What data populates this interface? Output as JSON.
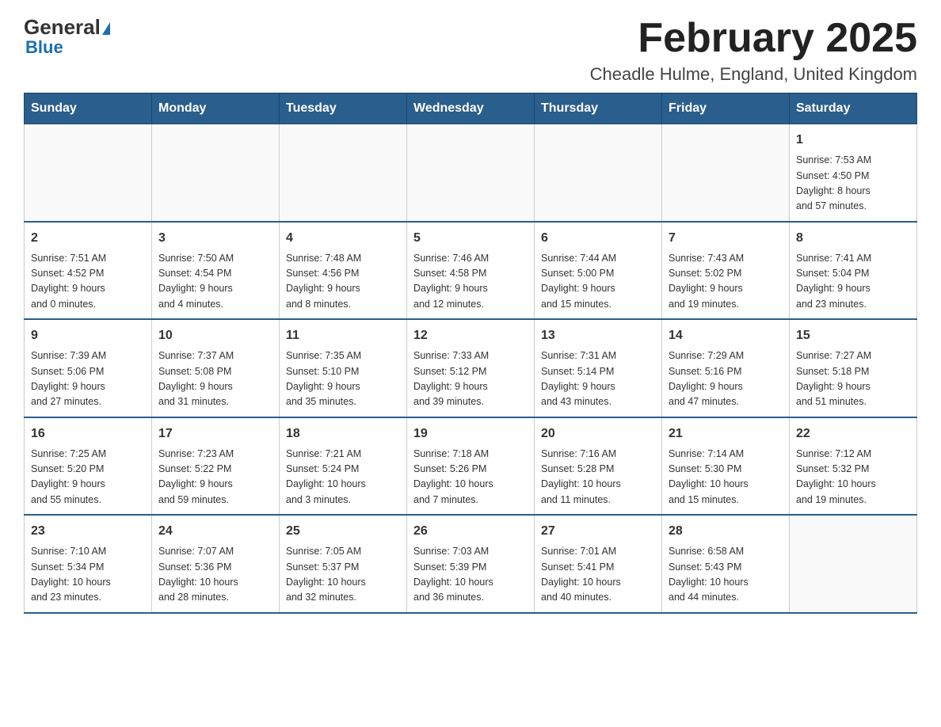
{
  "logo": {
    "general": "General",
    "blue": "Blue"
  },
  "title": "February 2025",
  "subtitle": "Cheadle Hulme, England, United Kingdom",
  "weekdays": [
    "Sunday",
    "Monday",
    "Tuesday",
    "Wednesday",
    "Thursday",
    "Friday",
    "Saturday"
  ],
  "weeks": [
    [
      {
        "day": "",
        "info": ""
      },
      {
        "day": "",
        "info": ""
      },
      {
        "day": "",
        "info": ""
      },
      {
        "day": "",
        "info": ""
      },
      {
        "day": "",
        "info": ""
      },
      {
        "day": "",
        "info": ""
      },
      {
        "day": "1",
        "info": "Sunrise: 7:53 AM\nSunset: 4:50 PM\nDaylight: 8 hours\nand 57 minutes."
      }
    ],
    [
      {
        "day": "2",
        "info": "Sunrise: 7:51 AM\nSunset: 4:52 PM\nDaylight: 9 hours\nand 0 minutes."
      },
      {
        "day": "3",
        "info": "Sunrise: 7:50 AM\nSunset: 4:54 PM\nDaylight: 9 hours\nand 4 minutes."
      },
      {
        "day": "4",
        "info": "Sunrise: 7:48 AM\nSunset: 4:56 PM\nDaylight: 9 hours\nand 8 minutes."
      },
      {
        "day": "5",
        "info": "Sunrise: 7:46 AM\nSunset: 4:58 PM\nDaylight: 9 hours\nand 12 minutes."
      },
      {
        "day": "6",
        "info": "Sunrise: 7:44 AM\nSunset: 5:00 PM\nDaylight: 9 hours\nand 15 minutes."
      },
      {
        "day": "7",
        "info": "Sunrise: 7:43 AM\nSunset: 5:02 PM\nDaylight: 9 hours\nand 19 minutes."
      },
      {
        "day": "8",
        "info": "Sunrise: 7:41 AM\nSunset: 5:04 PM\nDaylight: 9 hours\nand 23 minutes."
      }
    ],
    [
      {
        "day": "9",
        "info": "Sunrise: 7:39 AM\nSunset: 5:06 PM\nDaylight: 9 hours\nand 27 minutes."
      },
      {
        "day": "10",
        "info": "Sunrise: 7:37 AM\nSunset: 5:08 PM\nDaylight: 9 hours\nand 31 minutes."
      },
      {
        "day": "11",
        "info": "Sunrise: 7:35 AM\nSunset: 5:10 PM\nDaylight: 9 hours\nand 35 minutes."
      },
      {
        "day": "12",
        "info": "Sunrise: 7:33 AM\nSunset: 5:12 PM\nDaylight: 9 hours\nand 39 minutes."
      },
      {
        "day": "13",
        "info": "Sunrise: 7:31 AM\nSunset: 5:14 PM\nDaylight: 9 hours\nand 43 minutes."
      },
      {
        "day": "14",
        "info": "Sunrise: 7:29 AM\nSunset: 5:16 PM\nDaylight: 9 hours\nand 47 minutes."
      },
      {
        "day": "15",
        "info": "Sunrise: 7:27 AM\nSunset: 5:18 PM\nDaylight: 9 hours\nand 51 minutes."
      }
    ],
    [
      {
        "day": "16",
        "info": "Sunrise: 7:25 AM\nSunset: 5:20 PM\nDaylight: 9 hours\nand 55 minutes."
      },
      {
        "day": "17",
        "info": "Sunrise: 7:23 AM\nSunset: 5:22 PM\nDaylight: 9 hours\nand 59 minutes."
      },
      {
        "day": "18",
        "info": "Sunrise: 7:21 AM\nSunset: 5:24 PM\nDaylight: 10 hours\nand 3 minutes."
      },
      {
        "day": "19",
        "info": "Sunrise: 7:18 AM\nSunset: 5:26 PM\nDaylight: 10 hours\nand 7 minutes."
      },
      {
        "day": "20",
        "info": "Sunrise: 7:16 AM\nSunset: 5:28 PM\nDaylight: 10 hours\nand 11 minutes."
      },
      {
        "day": "21",
        "info": "Sunrise: 7:14 AM\nSunset: 5:30 PM\nDaylight: 10 hours\nand 15 minutes."
      },
      {
        "day": "22",
        "info": "Sunrise: 7:12 AM\nSunset: 5:32 PM\nDaylight: 10 hours\nand 19 minutes."
      }
    ],
    [
      {
        "day": "23",
        "info": "Sunrise: 7:10 AM\nSunset: 5:34 PM\nDaylight: 10 hours\nand 23 minutes."
      },
      {
        "day": "24",
        "info": "Sunrise: 7:07 AM\nSunset: 5:36 PM\nDaylight: 10 hours\nand 28 minutes."
      },
      {
        "day": "25",
        "info": "Sunrise: 7:05 AM\nSunset: 5:37 PM\nDaylight: 10 hours\nand 32 minutes."
      },
      {
        "day": "26",
        "info": "Sunrise: 7:03 AM\nSunset: 5:39 PM\nDaylight: 10 hours\nand 36 minutes."
      },
      {
        "day": "27",
        "info": "Sunrise: 7:01 AM\nSunset: 5:41 PM\nDaylight: 10 hours\nand 40 minutes."
      },
      {
        "day": "28",
        "info": "Sunrise: 6:58 AM\nSunset: 5:43 PM\nDaylight: 10 hours\nand 44 minutes."
      },
      {
        "day": "",
        "info": ""
      }
    ]
  ]
}
